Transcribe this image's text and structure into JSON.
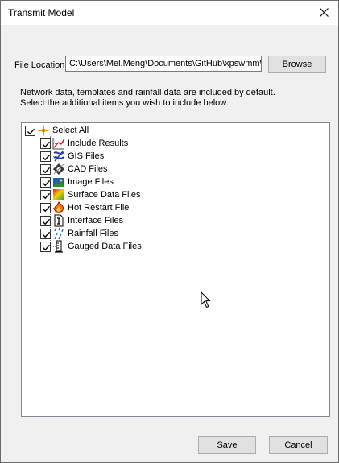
{
  "window": {
    "title": "Transmit Model"
  },
  "file_location": {
    "label": "File Location",
    "value": "C:\\Users\\Mel.Meng\\Documents\\GitHub\\xpswmm\\r"
  },
  "browse_label": "Browse",
  "info_lines": [
    "Network data, templates and rainfall data are included by default.",
    "Select the additional items you wish to include below."
  ],
  "tree": {
    "select_all": {
      "label": "Select All",
      "checked": true,
      "icon": "sparkle-icon"
    },
    "items": [
      {
        "label": "Include Results",
        "checked": true,
        "icon": "results-chart-icon"
      },
      {
        "label": "GIS Files",
        "checked": true,
        "icon": "gis-icon"
      },
      {
        "label": "CAD Files",
        "checked": true,
        "icon": "cad-icon"
      },
      {
        "label": "Image Files",
        "checked": true,
        "icon": "image-icon"
      },
      {
        "label": "Surface Data Files",
        "checked": true,
        "icon": "surface-data-icon"
      },
      {
        "label": "Hot Restart File",
        "checked": true,
        "icon": "hot-restart-icon"
      },
      {
        "label": "Interface Files",
        "checked": true,
        "icon": "interface-icon"
      },
      {
        "label": "Rainfall Files",
        "checked": true,
        "icon": "rainfall-icon"
      },
      {
        "label": "Gauged Data Files",
        "checked": true,
        "icon": "gauge-icon"
      }
    ]
  },
  "buttons": {
    "save": "Save",
    "cancel": "Cancel"
  },
  "colors": {
    "dialog_bg": "#f0f0f0",
    "button_bg": "#e1e1e1",
    "border": "#adadad"
  }
}
